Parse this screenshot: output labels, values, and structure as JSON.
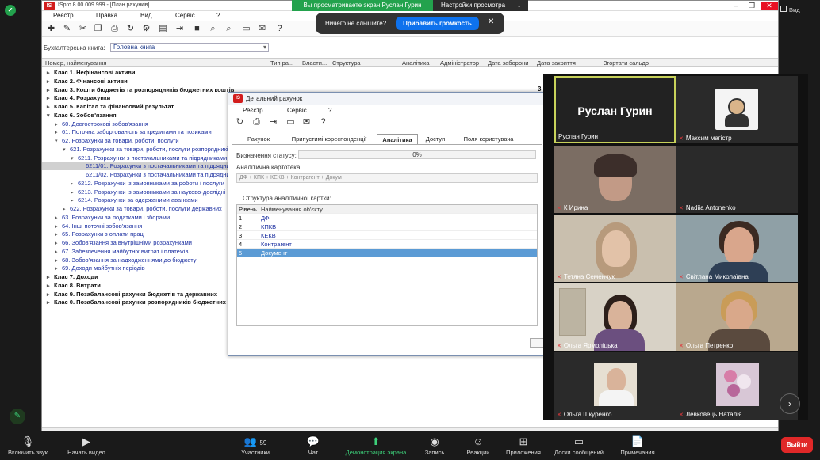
{
  "app": {
    "title": "ISpro 8.00.009.999 - [План рахунків]",
    "logo": "IS",
    "menu": [
      "Реєстр",
      "Правка",
      "Вид",
      "Сервіс",
      "?"
    ],
    "book_label": "Бухгалтерська книга:",
    "book_value": "Головна книга",
    "columns": [
      "Номер, найменування",
      "Тип ра...",
      "Власти...",
      "Структура",
      "Аналітика",
      "Адміністратор",
      "Дата заборони",
      "Дата закриття",
      "Згортати сальдо"
    ],
    "tree": [
      {
        "text": "Клас 1. Нефінансові активи",
        "style": "bold"
      },
      {
        "text": "Клас 2. Фінансові активи",
        "style": "bold"
      },
      {
        "text": "Клас 3. Кошти бюджетів та розпорядників бюджетних коштів",
        "style": "bold"
      },
      {
        "text": "Клас 4. Розрахунки",
        "style": "bold"
      },
      {
        "text": "Клас 5. Капітал та фінансовий результат",
        "style": "bold"
      },
      {
        "text": "Клас 6. Зобов'язання",
        "style": "bold"
      },
      {
        "text": "60. Довгострокові зобов'язання",
        "style": "blue"
      },
      {
        "text": "61. Поточна заборгованість за кредитами та позиками",
        "style": "blue"
      },
      {
        "text": "62. Розрахунки за товари, роботи, послуги",
        "style": "blue"
      },
      {
        "text": "621. Розрахунки за товари, роботи, послуги розпорядників",
        "style": "blue"
      },
      {
        "text": "6211. Розрахунки з постачальниками та підрядниками",
        "style": "blue"
      },
      {
        "text": "6211/01. Розрахунки з постачальниками та підрядниками",
        "style": "blue"
      },
      {
        "text": "6211/02. Розрахунки з постачальниками та підрядниками",
        "style": "blue"
      },
      {
        "text": "6212. Розрахунки із замовниками за роботи і послуги",
        "style": "blue"
      },
      {
        "text": "6213. Розрахунки із замовниками за науково-дослідні",
        "style": "blue"
      },
      {
        "text": "6214. Розрахунки за одержаними авансами",
        "style": "blue"
      },
      {
        "text": "622. Розрахунки за товари, роботи, послуги державних",
        "style": "blue"
      },
      {
        "text": "63. Розрахунки за податками і зборами",
        "style": "blue"
      },
      {
        "text": "64. Інші поточні зобов'язання",
        "style": "blue"
      },
      {
        "text": "65. Розрахунки з оплати праці",
        "style": "blue"
      },
      {
        "text": "66. Зобов'язання за внутрішніми розрахунками",
        "style": "blue"
      },
      {
        "text": "67. Забезпечення майбутніх витрат і платежів",
        "style": "blue"
      },
      {
        "text": "68. Зобов'язання за надходженнями до бюджету",
        "style": "blue"
      },
      {
        "text": "69. Доходи майбутніх періодів",
        "style": "blue"
      },
      {
        "text": "Клас 7. Доходи",
        "style": "bold"
      },
      {
        "text": "Клас 8. Витрати",
        "style": "bold"
      },
      {
        "text": "Клас 9. Позабалансові рахунки бюджетів та державних",
        "style": "bold"
      },
      {
        "text": "Клас 0. Позабалансові рахунки розпорядників бюджетних",
        "style": "bold"
      }
    ],
    "side_count": "3"
  },
  "dialog": {
    "title": "Детальний рахунок",
    "menu": [
      "Реєстр",
      "Сервіс",
      "?"
    ],
    "tabs": [
      "Рахунок",
      "Припустимі кореспонденції",
      "Аналітика",
      "Доступ",
      "Поля користувача"
    ],
    "status_label": "Визначення статусу:",
    "progress": "0%",
    "card_label": "Аналітична картотека:",
    "card_value": "ДФ + КПК + КЕКВ + Контрагент + Докум",
    "struct_label": "Структура аналітичної картки:",
    "grid_headers": [
      "Рівень",
      "Найменування об'єкту"
    ],
    "grid_rows": [
      {
        "level": "1",
        "name": "ДФ"
      },
      {
        "level": "2",
        "name": "КПКВ"
      },
      {
        "level": "3",
        "name": "КЕКВ"
      },
      {
        "level": "4",
        "name": "Контрагент"
      },
      {
        "level": "5",
        "name": "Документ"
      }
    ]
  },
  "zoom": {
    "view_banner": "Вы просматриваете экран Руслан Гурин",
    "view_settings": "Настройки просмотра",
    "toast_question": "Ничего не слышите?",
    "toast_button": "Прибавить громкость",
    "view_label": "Вид",
    "participants": [
      "Руслан Гурин",
      "Максим магістр",
      "К Ирина",
      "Nadiia Antonenko",
      "Тетяна Семенчук",
      "Світлана Миколаївна",
      "Ольга Ярмоліцька",
      "Ольга Петренко",
      "Ольга Шкуренко",
      "Левковець Наталія"
    ],
    "speaker_big_name": "Руслан Гурин",
    "participant_count": "59",
    "toolbar": [
      "Включить звук",
      "Начать видео",
      "Участники",
      "Чат",
      "Демонстрация экрана",
      "Запись",
      "Реакции",
      "Приложения",
      "Доски сообщений",
      "Примечания"
    ],
    "leave": "Выйти",
    "colors": {
      "accent_green": "#23a24d",
      "accent_blue": "#0e72ed",
      "leave_red": "#e02828",
      "active_speaker": "#c8d25a"
    }
  }
}
